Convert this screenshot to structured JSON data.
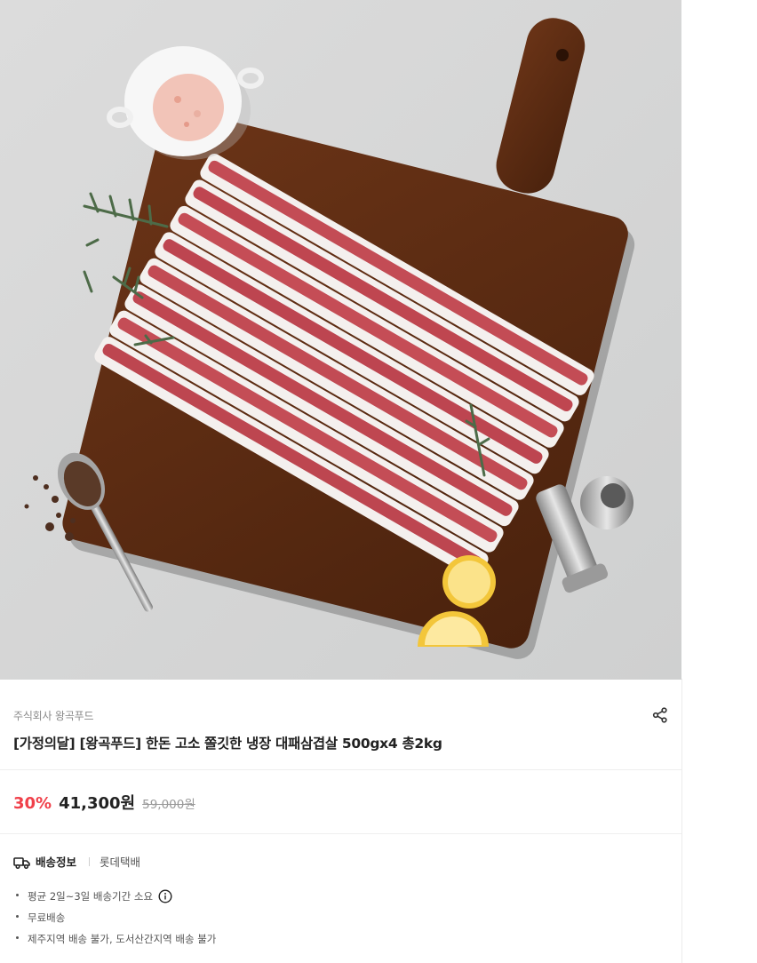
{
  "product": {
    "seller": "주식회사 왕곡푸드",
    "title": "[가정의달] [왕곡푸드] 한돈 고소 쫄깃한 냉장 대패삼겹살 500gx4 총2kg",
    "image_alt": "대패삼겹살 상품 이미지"
  },
  "price": {
    "discount": "30%",
    "sale": "41,300원",
    "original": "59,000원"
  },
  "shipping": {
    "label": "배송정보",
    "carrier": "롯데택배",
    "items": [
      "평균 2일~3일 배송기간 소요",
      "무료배송",
      "제주지역 배송 불가, 도서산간지역 배송 불가"
    ]
  },
  "icons": {
    "share": "share-icon",
    "truck": "truck-icon",
    "info": "info-circle-icon"
  },
  "colors": {
    "discount": "#f0404a",
    "text": "#222222",
    "muted": "#8a8a8a"
  }
}
